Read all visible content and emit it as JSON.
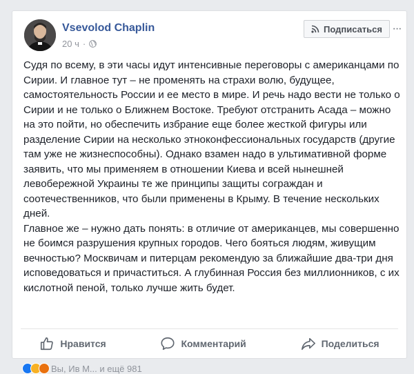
{
  "post": {
    "author": "Vsevolod Chaplin",
    "time": "20 ч",
    "separator": "·",
    "subscribe_label": "Подписаться",
    "more_label": "···",
    "paragraphs": [
      "Судя по всему, в эти часы идут интенсивные переговоры с американцами по Сирии. И главное тут – не променять на страхи волю, будущее, самостоятельность России и ее место в мире. И речь надо вести не только о Сирии и не только о Ближнем Востоке. Требуют отстранить Асада – можно на это пойти, но обеспечить избрание еще более жесткой фигуры или разделение Сирии на несколько этноконфессиональных государств (другие там уже не жизнеспособны). Однако взамен надо в ультимативной форме заявить, что мы применяем в отношении Киева и всей нынешней левобережной Украины те же принципы защиты сограждан и соотечественников, что были применены в Крыму. В течение нескольких дней.",
      "Главное же – нужно дать понять: в отличие от американцев, мы совершенно не боимся разрушения крупных городов. Чего бояться людям, живущим вечностью? Москвичам и питерцам рекомендую за ближайшие два-три дня исповедоваться и причаститься. А глубинная Россия без миллионников, с их кислотной пеной, только лучше жить будет."
    ]
  },
  "actions": {
    "like_label": "Нравится",
    "comment_label": "Комментарий",
    "share_label": "Поделиться"
  },
  "reactions": {
    "summary": "Вы, Ив М... и ещё 981"
  },
  "colors": {
    "author_link": "#365899",
    "background": "#e9ebee",
    "action_text": "#606770"
  }
}
